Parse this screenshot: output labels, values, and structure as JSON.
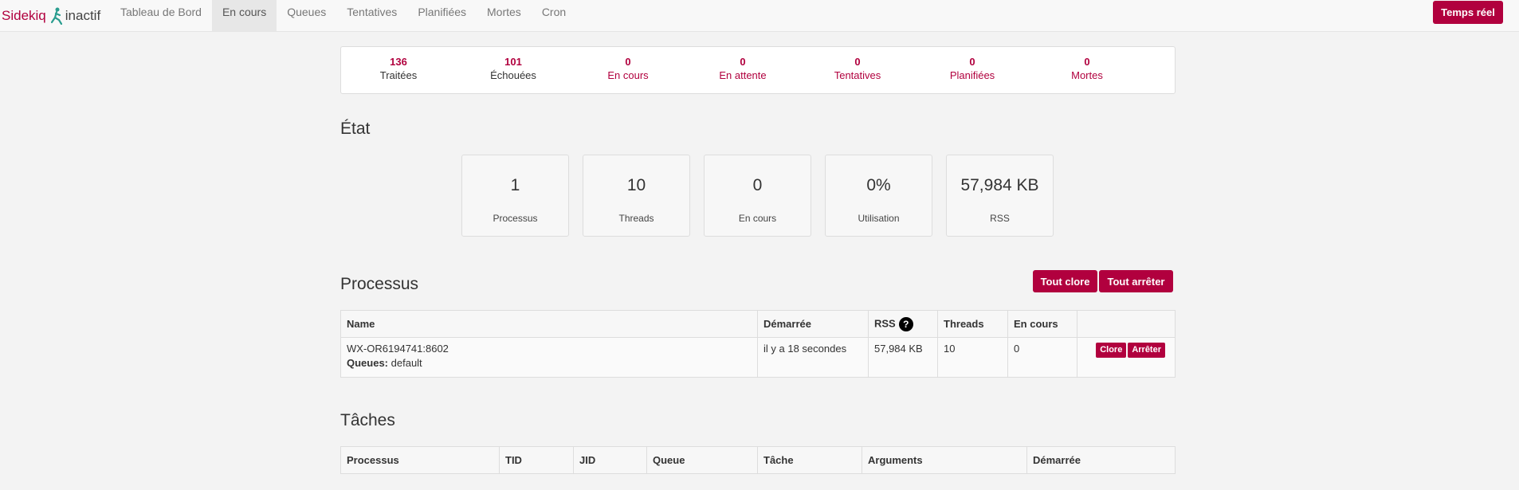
{
  "navbar": {
    "brand": "Sidekiq",
    "status": "inactif",
    "items": [
      {
        "label": "Tableau de Bord"
      },
      {
        "label": "En cours"
      },
      {
        "label": "Queues"
      },
      {
        "label": "Tentatives"
      },
      {
        "label": "Planifiées"
      },
      {
        "label": "Mortes"
      },
      {
        "label": "Cron"
      }
    ],
    "active_index": 1,
    "live_button": "Temps réel"
  },
  "summary": [
    {
      "count": "136",
      "label": "Traitées",
      "link": false
    },
    {
      "count": "101",
      "label": "Échouées",
      "link": false
    },
    {
      "count": "0",
      "label": "En cours",
      "link": true
    },
    {
      "count": "0",
      "label": "En attente",
      "link": true
    },
    {
      "count": "0",
      "label": "Tentatives",
      "link": true
    },
    {
      "count": "0",
      "label": "Planifiées",
      "link": true
    },
    {
      "count": "0",
      "label": "Mortes",
      "link": true
    }
  ],
  "state": {
    "heading": "État",
    "stats": [
      {
        "value": "1",
        "label": "Processus"
      },
      {
        "value": "10",
        "label": "Threads"
      },
      {
        "value": "0",
        "label": "En cours"
      },
      {
        "value": "0%",
        "label": "Utilisation"
      },
      {
        "value": "57,984 KB",
        "label": "RSS"
      }
    ]
  },
  "processes": {
    "heading": "Processus",
    "quiet_all": "Tout clore",
    "stop_all": "Tout arrêter",
    "columns": [
      "Name",
      "Démarrée",
      "RSS",
      "Threads",
      "En cours",
      ""
    ],
    "help_glyph": "?",
    "rows": [
      {
        "name": "WX-OR6194741:8602",
        "queues_label": "Queues:",
        "queues": "default",
        "started": "il y a 18 secondes",
        "rss": "57,984 KB",
        "threads": "10",
        "busy": "0",
        "quiet": "Clore",
        "stop": "Arrêter"
      }
    ]
  },
  "jobs": {
    "heading": "Tâches",
    "columns": [
      "Processus",
      "TID",
      "JID",
      "Queue",
      "Tâche",
      "Arguments",
      "Démarrée"
    ]
  },
  "colors": {
    "accent": "#b1003e",
    "background": "#f3f3f3"
  }
}
